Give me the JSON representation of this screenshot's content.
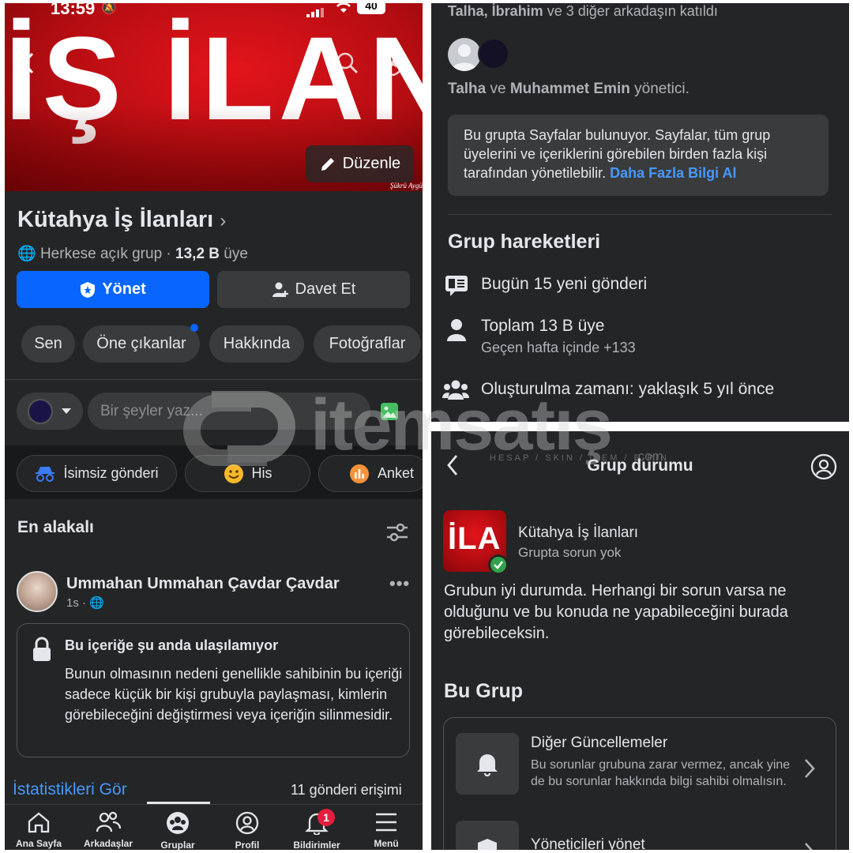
{
  "left": {
    "status_time": "13:59",
    "battery": "40",
    "cover_text": "İŞ İLANI",
    "cover_signature": "Şükrü Aygü",
    "edit_label": "Düzenle",
    "group_name": "Kütahya İş İlanları",
    "privacy": "Herkese açık grup · ",
    "member_count": "13,2 B",
    "member_suffix": " üye",
    "manage_label": "Yönet",
    "invite_label": "Davet Et",
    "chips": [
      "Sen",
      "Öne çıkanlar",
      "Hakkında",
      "Fotoğraflar"
    ],
    "composer_placeholder": "Bir şeyler yaz...",
    "actions": [
      "İsimsiz gönderi",
      "His",
      "Anket"
    ],
    "feed_title": "En alakalı",
    "post_author": "Ummahan Ummahan Çavdar Çavdar",
    "post_time": "1s ·",
    "locked_title": "Bu içeriğe şu anda ulaşılamıyor",
    "locked_body": "Bunun olmasının nedeni genellikle sahibinin bu içeriği sadece küçük bir kişi grubuyla paylaşması, kimlerin görebileceğini değiştirmesi veya içeriğin silinmesidir.",
    "stats_link": "İstatistikleri Gör",
    "reach": "11 gönderi erişimi",
    "tabs": [
      "Ana Sayfa",
      "Arkadaşlar",
      "Gruplar",
      "Profil",
      "Bildirimler",
      "Menü"
    ],
    "notif_badge": "1"
  },
  "top_right": {
    "joined_names": "Talha, İbrahim",
    "joined_suffix": " ve 3 diğer arkadaşın katıldı",
    "admin_name_1": "Talha",
    "admin_and": " ve ",
    "admin_name_2": "Muhammet Emin",
    "admin_suffix": " yönetici.",
    "pages_notice": "Bu grupta Sayfalar bulunuyor. Sayfalar, tüm grup üyelerini ve içeriklerini görebilen birden fazla kişi tarafından yönetilebilir. ",
    "learn_more": "Daha Fazla Bilgi Al",
    "activity_title": "Grup hareketleri",
    "posts_today": "Bugün 15 yeni gönderi",
    "total_members": "Toplam 13 B üye",
    "last_week": "Geçen hafta içinde +133",
    "created": "Oluşturulma zamanı: yaklaşık 5 yıl önce"
  },
  "bottom_right": {
    "title": "Grup durumu",
    "group_name": "Kütahya İş İlanları",
    "status": "Grupta sorun yok",
    "logo_text": "İLA",
    "summary": "Grubun iyi durumda. Herhangi bir sorun varsa ne olduğunu ve bu konuda ne yapabileceğini burada görebileceksin.",
    "section_title": "Bu Grup",
    "item1_title": "Diğer Güncellemeler",
    "item1_body": "Bu sorunlar grubuna zarar vermez, ancak yine de bu sorunlar hakkında bilgi sahibi olmalısın.",
    "item2_title": "Yöneticileri yönet"
  },
  "watermark": {
    "brand": "itemsatış",
    "tagline": "HESAP / SKIN / ITEM / E-PIN",
    "suffix": ".com"
  },
  "colors": {
    "background": "#242526",
    "accent_blue": "#0866ff",
    "link_blue": "#4599ff",
    "cover_red": "#d5121a",
    "success_green": "#31a24c",
    "badge_red": "#e41e3f"
  }
}
